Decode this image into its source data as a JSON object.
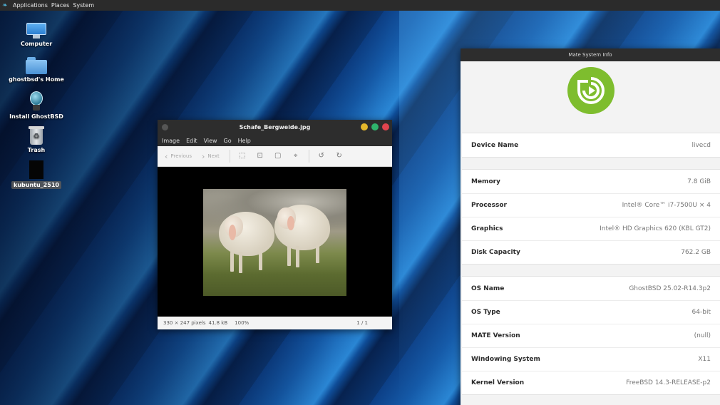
{
  "panel": {
    "menus": [
      "Applications",
      "Places",
      "System"
    ]
  },
  "desktop": {
    "icons": [
      {
        "label": "Computer",
        "icon": "computer-icon"
      },
      {
        "label": "ghostbsd's Home",
        "icon": "home-folder-icon"
      },
      {
        "label": "Install GhostBSD",
        "icon": "installer-icon"
      },
      {
        "label": "Trash",
        "icon": "trash-icon"
      },
      {
        "label": "kubuntu_2510",
        "icon": "file-icon"
      }
    ]
  },
  "viewer": {
    "title": "Schafe_Bergweide.jpg",
    "menus": [
      "Image",
      "Edit",
      "View",
      "Go",
      "Help"
    ],
    "toolbar": {
      "previous": "Previous",
      "next": "Next"
    },
    "status": {
      "dimensions": "330 × 247 pixels",
      "size": "41.8 kB",
      "zoom": "100%",
      "page": "1 / 1"
    },
    "window_buttons_colors": [
      "#e5b82b",
      "#2fb36c",
      "#e0444e"
    ]
  },
  "sysinfo": {
    "title": "Mate System Info",
    "logo_color": "#7ebd2e",
    "groups": [
      [
        {
          "key": "Device Name",
          "value": "livecd"
        }
      ],
      [
        {
          "key": "Memory",
          "value": "7.8 GiB"
        },
        {
          "key": "Processor",
          "value": "Intel® Core™ i7-7500U × 4"
        },
        {
          "key": "Graphics",
          "value": "Intel® HD Graphics 620 (KBL GT2)"
        },
        {
          "key": "Disk Capacity",
          "value": "762.2 GB"
        }
      ],
      [
        {
          "key": "OS Name",
          "value": "GhostBSD 25.02-R14.3p2"
        },
        {
          "key": "OS Type",
          "value": "64-bit"
        },
        {
          "key": "MATE Version",
          "value": "(null)"
        },
        {
          "key": "Windowing System",
          "value": "X11"
        },
        {
          "key": "Kernel Version",
          "value": "FreeBSD 14.3-RELEASE-p2"
        }
      ]
    ]
  }
}
